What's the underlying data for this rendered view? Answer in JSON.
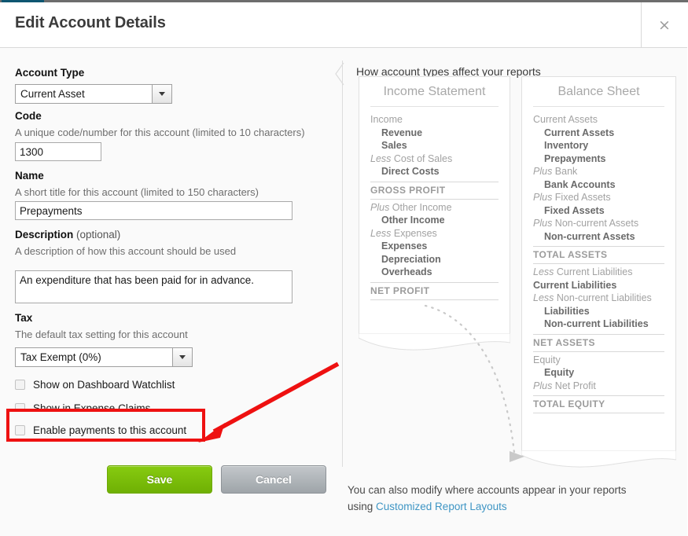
{
  "window": {
    "title": "Edit Account Details",
    "close_icon": "close-icon",
    "close_glyph": "×",
    "accent_color": "#0e5671"
  },
  "form": {
    "account_type": {
      "label": "Account Type",
      "value": "Current Asset"
    },
    "code": {
      "label": "Code",
      "hint": "A unique code/number for this account (limited to 10 characters)",
      "value": "1300"
    },
    "name": {
      "label": "Name",
      "hint": "A short title for this account (limited to 150 characters)",
      "value": "Prepayments"
    },
    "description": {
      "label": "Description",
      "label_optional": " (optional)",
      "hint": "A description of how this account should be used",
      "value": "An expenditure that has been paid for in advance."
    },
    "tax": {
      "label": "Tax",
      "hint": "The default tax setting for this account",
      "value": "Tax Exempt (0%)"
    },
    "checkboxes": [
      {
        "label": "Show on Dashboard Watchlist",
        "checked": false
      },
      {
        "label": "Show in Expense Claims",
        "checked": false
      },
      {
        "label": "Enable payments to this account",
        "checked": false
      }
    ],
    "buttons": {
      "save": "Save",
      "cancel": "Cancel"
    }
  },
  "annotations": {
    "highlight_color": "#ee1111",
    "arrow_color": "#ee1111",
    "highlight_target": "Enable payments to this account"
  },
  "help": {
    "heading": "How account types affect your reports",
    "footer_text_1": "You can also modify where accounts appear in your reports",
    "footer_text_2": "using ",
    "footer_link": "Customized Report Layouts",
    "income_statement": {
      "title": "Income Statement",
      "rows": [
        {
          "type": "group",
          "keyword": "",
          "text": "Income"
        },
        {
          "type": "item",
          "text": "Revenue"
        },
        {
          "type": "item",
          "text": "Sales"
        },
        {
          "type": "group",
          "keyword": "Less ",
          "text": "Cost of Sales"
        },
        {
          "type": "item",
          "text": "Direct Costs"
        },
        {
          "type": "total",
          "text": "GROSS PROFIT"
        },
        {
          "type": "group",
          "keyword": "Plus ",
          "text": "Other Income"
        },
        {
          "type": "item",
          "text": "Other Income"
        },
        {
          "type": "group",
          "keyword": "Less ",
          "text": "Expenses"
        },
        {
          "type": "item",
          "text": "Expenses"
        },
        {
          "type": "item",
          "text": "Depreciation"
        },
        {
          "type": "item",
          "text": "Overheads"
        },
        {
          "type": "total",
          "text": "NET PROFIT"
        }
      ]
    },
    "balance_sheet": {
      "title": "Balance Sheet",
      "rows": [
        {
          "type": "group",
          "keyword": "",
          "text": "Current Assets"
        },
        {
          "type": "item",
          "text": "Current Assets"
        },
        {
          "type": "item",
          "text": "Inventory"
        },
        {
          "type": "item",
          "text": "Prepayments"
        },
        {
          "type": "group",
          "keyword": "Plus ",
          "text": "Bank"
        },
        {
          "type": "item",
          "text": "Bank Accounts"
        },
        {
          "type": "group",
          "keyword": "Plus ",
          "text": "Fixed Assets"
        },
        {
          "type": "item",
          "text": "Fixed Assets"
        },
        {
          "type": "group",
          "keyword": "Plus ",
          "text": "Non-current Assets"
        },
        {
          "type": "item",
          "text": "Non-current Assets"
        },
        {
          "type": "total",
          "text": "TOTAL ASSETS"
        },
        {
          "type": "group",
          "keyword": "Less ",
          "text": "Current Liabilities"
        },
        {
          "type": "item-flush",
          "text": "Current Liabilities"
        },
        {
          "type": "group",
          "keyword": "Less ",
          "text": "Non-current Liabilities"
        },
        {
          "type": "item",
          "text": "Liabilities"
        },
        {
          "type": "item",
          "text": "Non-current Liabilities"
        },
        {
          "type": "total",
          "text": "NET ASSETS"
        },
        {
          "type": "group",
          "keyword": "",
          "text": "Equity"
        },
        {
          "type": "item",
          "text": "Equity"
        },
        {
          "type": "group",
          "keyword": "Plus ",
          "text": "Net Profit"
        },
        {
          "type": "total",
          "text": "TOTAL EQUITY"
        }
      ]
    }
  }
}
